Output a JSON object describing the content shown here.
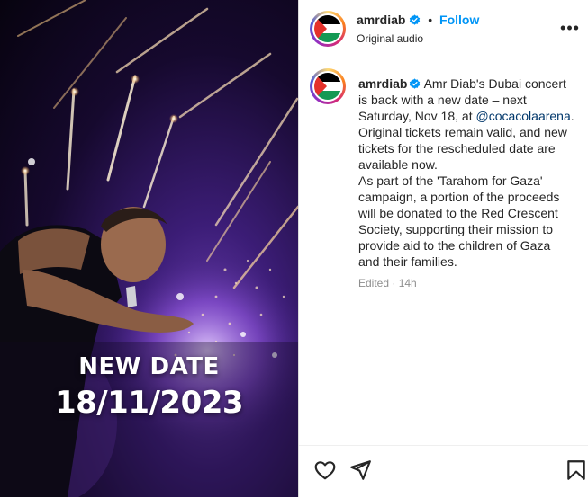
{
  "media": {
    "overlay_line1": "NEW DATE",
    "overlay_line2": "18/11/2023"
  },
  "header": {
    "username": "amrdiab",
    "separator": "•",
    "follow_label": "Follow",
    "audio_label": "Original audio",
    "more_icon": "more-horizontal-icon",
    "more_glyph": "•••"
  },
  "caption": {
    "username": "amrdiab",
    "text_before_mention": " Amr Diab's Dubai concert is back with a new date – next Saturday, Nov 18, at ",
    "mention": "@cocacolaarena",
    "text_after_mention": ". Original tickets remain valid, and new tickets for the rescheduled date are available now.",
    "paragraph2": "As part of the 'Tarahom for Gaza' campaign, a portion of the proceeds will be donated to the Red Crescent Society, supporting their mission to provide aid to the children of Gaza and their families."
  },
  "meta": {
    "edited_label": "Edited · 14h"
  },
  "actions": {
    "icons": [
      "heart-icon",
      "share-icon",
      "bookmark-icon"
    ]
  },
  "colors": {
    "follow": "#0095f6",
    "mention": "#00376b",
    "verified": "#0095f6",
    "text": "#262626",
    "muted": "#8e8e8e"
  }
}
